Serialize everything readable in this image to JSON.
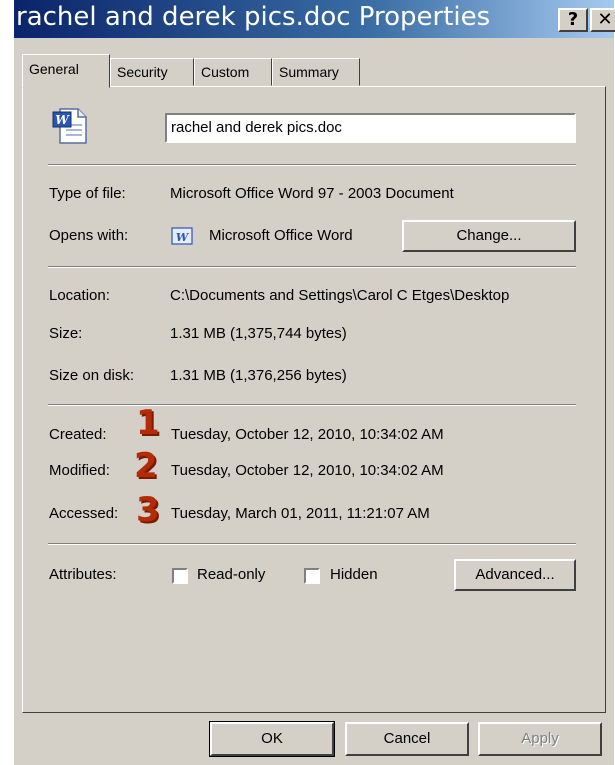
{
  "window": {
    "title": "rachel and derek pics.doc Properties",
    "help_label": "?",
    "close_label": "✕"
  },
  "tabs": [
    {
      "label": "General"
    },
    {
      "label": "Security"
    },
    {
      "label": "Custom"
    },
    {
      "label": "Summary"
    }
  ],
  "general": {
    "filename": "rachel and derek pics.doc",
    "type_label": "Type of file:",
    "type_value": "Microsoft Office Word 97 - 2003 Document",
    "opens_label": "Opens with:",
    "opens_value": "Microsoft Office Word",
    "change_button": "Change...",
    "location_label": "Location:",
    "location_value": "C:\\Documents and Settings\\Carol C Etges\\Desktop",
    "size_label": "Size:",
    "size_value": "1.31 MB (1,375,744 bytes)",
    "size_disk_label": "Size on disk:",
    "size_disk_value": "1.31 MB (1,376,256 bytes)",
    "created_label": "Created:",
    "created_value": "Tuesday, October 12, 2010, 10:34:02 AM",
    "modified_label": "Modified:",
    "modified_value": "Tuesday, October 12, 2010, 10:34:02 AM",
    "accessed_label": "Accessed:",
    "accessed_value": "Tuesday, March 01, 2011, 11:21:07 AM",
    "attributes_label": "Attributes:",
    "readonly_label": "Read-only",
    "readonly_checked": false,
    "hidden_label": "Hidden",
    "hidden_checked": false,
    "advanced_button": "Advanced..."
  },
  "markers": [
    "1",
    "2",
    "3"
  ],
  "footer": {
    "ok": "OK",
    "cancel": "Cancel",
    "apply": "Apply"
  },
  "icons": {
    "document": "word-document-icon",
    "app": "word-app-icon"
  },
  "colors": {
    "titlebar_start": "#0a246a",
    "titlebar_end": "#a6caf0",
    "dialog_bg": "#d4d0c8",
    "marker": "#b22c0a"
  }
}
